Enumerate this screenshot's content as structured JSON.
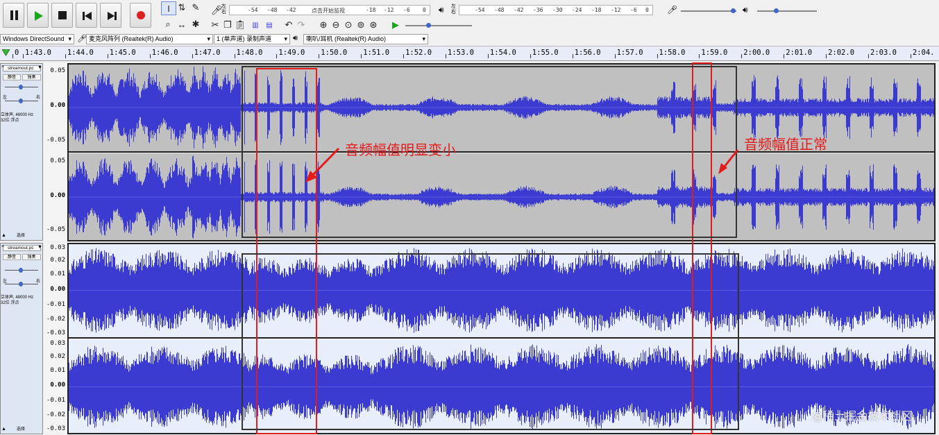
{
  "transport": {
    "buttons": [
      {
        "name": "pause-button",
        "glyph": "❚❚"
      },
      {
        "name": "play-button",
        "glyph": "▶"
      },
      {
        "name": "stop-button",
        "glyph": "■"
      },
      {
        "name": "skip-start-button",
        "glyph": "⏮"
      },
      {
        "name": "skip-end-button",
        "glyph": "⏭"
      },
      {
        "name": "record-button",
        "glyph": "●"
      }
    ]
  },
  "record_meter": {
    "channels": [
      "左",
      "右"
    ],
    "ticks": [
      "-54",
      "-48",
      "-42",
      "点击开始监视",
      "-18",
      "-12",
      "-6",
      "0"
    ]
  },
  "play_meter": {
    "channels": [
      "左",
      "右"
    ],
    "ticks": [
      "-54",
      "-48",
      "-42",
      "-36",
      "-30",
      "-24",
      "-18",
      "-12",
      "-6",
      "0"
    ]
  },
  "device_bar": {
    "host": "Windows DirectSound",
    "record_device": "麦克风阵列 (Realtek(R) Audio)",
    "record_channels": "1 (单声道) 录制声道",
    "playback_device": "喇叭/耳机 (Realtek(R) Audio)"
  },
  "timeline": {
    "labels": [
      "0",
      "1:43.0",
      "1:44.0",
      "1:45.0",
      "1:46.0",
      "1:47.0",
      "1:48.0",
      "1:49.0",
      "1:50.0",
      "1:51.0",
      "1:52.0",
      "1:53.0",
      "1:54.0",
      "1:55.0",
      "1:56.0",
      "1:57.0",
      "1:58.0",
      "1:59.0",
      "2:00.0",
      "2:01.0",
      "2:02.0",
      "2:03.0",
      "2:04."
    ]
  },
  "tracks": [
    {
      "name": "streamout.pc",
      "mute": "静音",
      "solo": "独奏",
      "pan_left": "左",
      "pan_right": "右",
      "info_line1": "立体声, 48000 Hz",
      "info_line2": "32位 浮点",
      "select": "选择",
      "scale": [
        "0.05",
        "0.00",
        "-0.05"
      ]
    },
    {
      "name": "streamout.pc",
      "mute": "静音",
      "solo": "独奏",
      "pan_left": "左",
      "pan_right": "右",
      "info_line1": "立体声, 48000 Hz",
      "info_line2": "32位 浮点",
      "select": "选择",
      "scale": [
        "0.03",
        "0.02",
        "0.01",
        "0.00",
        "-0.01",
        "-0.02",
        "-0.03"
      ]
    }
  ],
  "annotations": {
    "left": "音频幅值明显变小",
    "right": "音频幅值正常"
  },
  "watermark": "@稀土掘金技术社区",
  "colors": {
    "wave": "#3b3bd1",
    "highlight": "#e31b1b",
    "selected_bg": "#c0c0c0",
    "track_bg": "#e9eefb"
  }
}
